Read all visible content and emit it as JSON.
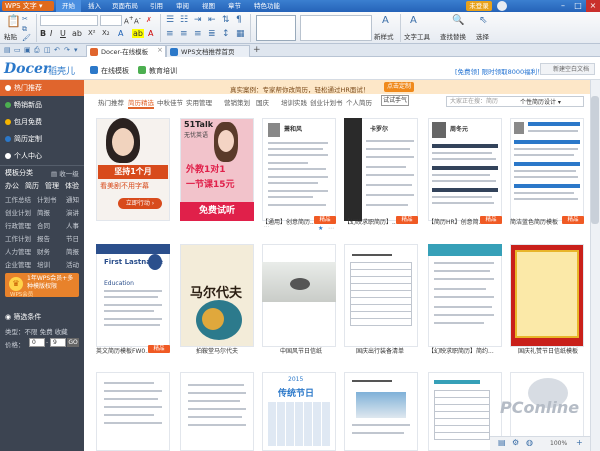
{
  "titlebar": {
    "app": "WPS 文字",
    "menus": [
      "开始",
      "插入",
      "页面布局",
      "引用",
      "审阅",
      "视图",
      "章节",
      "特色功能"
    ],
    "login": "未登录",
    "controls": [
      "–",
      "□",
      "×"
    ]
  },
  "ribbon": {
    "paste": "粘贴",
    "new_style": "新样式",
    "text_tool": "文字工具",
    "find_replace": "查找替换",
    "select": "选择"
  },
  "tabs": [
    {
      "label": "Docer-在线模板",
      "color": "#e0652d"
    },
    {
      "label": "WPS文档推荐首页",
      "color": "#2b78c9"
    }
  ],
  "header": {
    "logo": "Docer",
    "logo_cn": "稻壳儿",
    "nav": [
      "在线模板",
      "教育培训"
    ],
    "promo": "[免费领] 限时领取8000福利！",
    "new_window": "新建空白文档"
  },
  "sidebar": {
    "items": [
      {
        "label": "热门推荐",
        "color": "#e0652d",
        "selected": true
      },
      {
        "label": "畅销新品",
        "color": "#4caf50",
        "selected": false
      },
      {
        "label": "包月免费",
        "color": "#f5b400",
        "selected": false
      },
      {
        "label": "简历定制",
        "color": "#2b78c9",
        "selected": false
      },
      {
        "label": "个人中心",
        "color": "#ffffff",
        "selected": false
      }
    ],
    "category_title": "模板分类",
    "collapse": "收一级",
    "categories": [
      "办公",
      "简历",
      "管理",
      "体验"
    ],
    "subgrid": [
      "工作总结",
      "计划书",
      "通知",
      "创业计划",
      "简报",
      "演讲",
      "行政管理",
      "合同",
      "人事",
      "工作计划",
      "报告",
      "节日",
      "人力管理",
      "财务",
      "简报",
      "企业管理",
      "培训",
      "活动"
    ],
    "vip_text": "1年WPS会员+多种模版权限",
    "vip_sub": "WPS会员",
    "filter_title": "筛选条件",
    "filter_type": "类型：不限 免费 收藏",
    "filter_price": "价格：",
    "price_from": "0",
    "price_to": "9",
    "go": "GO"
  },
  "content": {
    "banner_text": "真实案例：专家帮你改简历，轻松通过HR面试！",
    "banner_button": "点击定制",
    "tabs": [
      "热门推荐",
      "简历精选",
      "中秋佳节",
      "实用管理",
      "营销策划",
      "国庆",
      "培训实践",
      "创业计划书",
      "个人简历"
    ],
    "try_button": "试试手气",
    "search_placeholder": "大家正在搜：简历",
    "search_select": "个性简历设计 ▾",
    "row1": [
      {
        "label": "",
        "tag": ""
      },
      {
        "label": "",
        "tag": ""
      },
      {
        "label": "【通用】创意简历...",
        "tag": "精品"
      },
      {
        "label": "【幻映求职简历】...",
        "tag": "精品"
      },
      {
        "label": "【简历HR】创意简...",
        "tag": "精品"
      },
      {
        "label": "简洁蓝色简历模板",
        "tag": "精品"
      }
    ],
    "row2": [
      {
        "label": "英文简历模板FW0...",
        "tag": "精品"
      },
      {
        "label": "拍鞍堂马尔代夫",
        "tag": ""
      },
      {
        "label": "中国风节日信纸",
        "tag": ""
      },
      {
        "label": "国庆出行装备清单",
        "tag": ""
      },
      {
        "label": "【幻映求职简历】简约...",
        "tag": ""
      },
      {
        "label": "国庆礼赞节日信纸模板",
        "tag": ""
      }
    ],
    "ad1": {
      "line1": "坚持1个月",
      "line2": "看美剧不用字幕",
      "button": "立即行动 ›"
    },
    "ad2": {
      "brand": "51Talk",
      "brand_sub": "无忧英语",
      "line1": "外教1对1",
      "line2": "一节课15元",
      "button": "免费试听"
    },
    "card2_title": "马尔代夫",
    "card3_name": "萧和风",
    "card4_name": "卡罗尔",
    "card5_name": "周冬元",
    "card7_title": "First Lastname",
    "card7_sub": "Education",
    "card11_year": "2015",
    "card11_title": "传统节日"
  },
  "status": {
    "zoom": "100%"
  },
  "watermark": "PConline"
}
